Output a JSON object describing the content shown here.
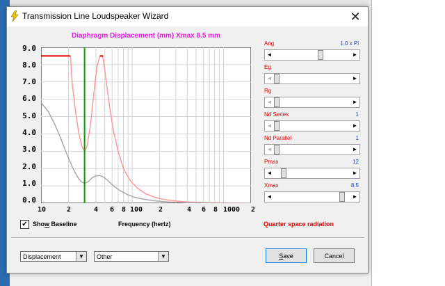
{
  "window": {
    "title": "Transmission Line Loudspeaker Wizard",
    "close_glyph": "✕"
  },
  "chart": {
    "title": "Diaphragm Displacement (mm)   Xmax 8.5 mm",
    "yticks": [
      "9.0",
      "8.0",
      "7.0",
      "6.0",
      "5.0",
      "4.0",
      "3.0",
      "2.0",
      "1.0",
      "0.0"
    ],
    "xticks": [
      "10",
      "2",
      "4",
      "6",
      "8",
      "100",
      "2",
      "4",
      "6",
      "8",
      "1000",
      "2"
    ],
    "xlabel": "Frequency (hertz)"
  },
  "chart_data": {
    "type": "line",
    "title": "Diaphragm Displacement (mm)   Xmax 8.5 mm",
    "xlabel": "Frequency (hertz)",
    "ylabel": "",
    "xscale": "log",
    "xlim": [
      10,
      2000
    ],
    "ylim": [
      0,
      9
    ],
    "grid": true,
    "series": [
      {
        "color": "#ff9999",
        "x": [
          21,
          22,
          24,
          26,
          28,
          30,
          32,
          35,
          38,
          41,
          44,
          46,
          47,
          48,
          50,
          53,
          57,
          62,
          70,
          80,
          95,
          115,
          140,
          180,
          250,
          400,
          700,
          1200,
          2000
        ],
        "y": [
          8.5,
          6.9,
          5.2,
          4.0,
          3.3,
          3.0,
          3.3,
          4.6,
          6.4,
          7.9,
          8.45,
          8.5,
          8.5,
          8.3,
          7.7,
          6.6,
          5.4,
          4.2,
          3.0,
          2.0,
          1.3,
          0.85,
          0.55,
          0.32,
          0.17,
          0.07,
          0.03,
          0.01,
          0.0
        ]
      },
      {
        "color": "#a8a8a8",
        "x": [
          10,
          12,
          14,
          16,
          18,
          20,
          22,
          24,
          26,
          28,
          30,
          33,
          36,
          40,
          44,
          48,
          53,
          58,
          65,
          75,
          90,
          110,
          140,
          180,
          250,
          400,
          700,
          1200,
          2000
        ],
        "y": [
          5.8,
          5.3,
          4.6,
          3.9,
          3.2,
          2.6,
          2.1,
          1.7,
          1.4,
          1.22,
          1.15,
          1.25,
          1.45,
          1.58,
          1.6,
          1.52,
          1.35,
          1.15,
          0.92,
          0.7,
          0.48,
          0.32,
          0.21,
          0.13,
          0.07,
          0.03,
          0.01,
          0.0,
          0.0
        ]
      },
      {
        "color": "#e00000",
        "x": [
          10,
          21
        ],
        "y": [
          8.5,
          8.5
        ]
      },
      {
        "color": "#e00000",
        "x": [
          44,
          48
        ],
        "y": [
          8.5,
          8.5
        ]
      }
    ],
    "markers": [
      {
        "x": 30,
        "color": "#00a000"
      }
    ]
  },
  "checkbox": {
    "checked_glyph": "✔",
    "label_pre": "Sho",
    "label_u": "w",
    "label_post": " Baseline"
  },
  "radiation_text": "Quarter space radiation",
  "sliders": [
    {
      "label": "Ang",
      "value": "1.0 x Pi",
      "position": 0.62
    },
    {
      "label": "Eg",
      "value": "",
      "position": 0.0
    },
    {
      "label": "Rg",
      "value": "",
      "position": 0.0
    },
    {
      "label": "Nd  Series",
      "value": "1",
      "position": 0.0
    },
    {
      "label": "Nd  Parallel",
      "value": "1",
      "position": 0.0
    },
    {
      "label": "Pmax",
      "value": "12",
      "position": 0.1
    },
    {
      "label": "Xmax",
      "value": "8.5",
      "position": 0.92
    }
  ],
  "arrows": {
    "left": "◄",
    "right": "►",
    "down": "▼"
  },
  "dropdowns": {
    "mode": "Displacement",
    "other": "Other"
  },
  "buttons": {
    "save_u": "S",
    "save_rest": "ave",
    "cancel": "Cancel"
  }
}
